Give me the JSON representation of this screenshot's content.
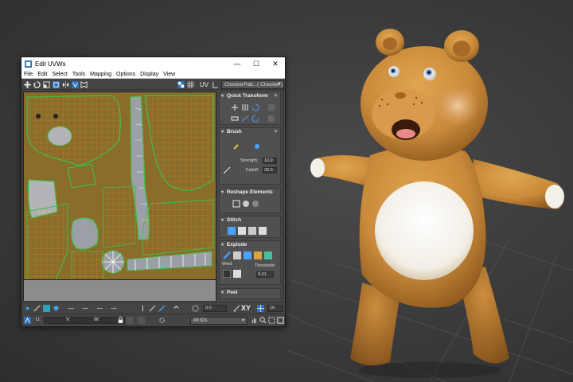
{
  "window": {
    "title": "Edit UVWs",
    "minimize": "—",
    "maximize": "☐",
    "close": "✕"
  },
  "menu": [
    "File",
    "Edit",
    "Select",
    "Tools",
    "Mapping",
    "Options",
    "Display",
    "View"
  ],
  "top_toolbar": {
    "uv_label": "UV",
    "checker_select": "CheckerPatt...( Checker )"
  },
  "rollouts": {
    "quick_transform": "Quick Transform",
    "brush": "Brush",
    "strength_label": "Strength:",
    "strength_value": "10.0",
    "falloff_label": "Falloff:",
    "falloff_value": "20.0",
    "reshape": "Reshape Elements",
    "stitch": "Stitch",
    "explode": "Explode",
    "weld_label": "Weld",
    "threshold_label": "Threshold:",
    "threshold_value": "0.01",
    "peel": "Peel"
  },
  "bottom_toolbar": {
    "angle_value": "0.0",
    "xy_label": "XY",
    "grid_value": "16"
  },
  "status_bar": {
    "u_label": "U:",
    "v_label": "V:",
    "w_label": "W:",
    "ids_select": "All IDs"
  },
  "colors": {
    "uv_background": "#8a6d2a",
    "uv_grid": "#c8892a",
    "uv_seam": "#3fbf4a",
    "uv_gray_island": "#9aa0a6",
    "bear_fur": "#c98a3a",
    "bear_belly": "#f4f1ea"
  }
}
